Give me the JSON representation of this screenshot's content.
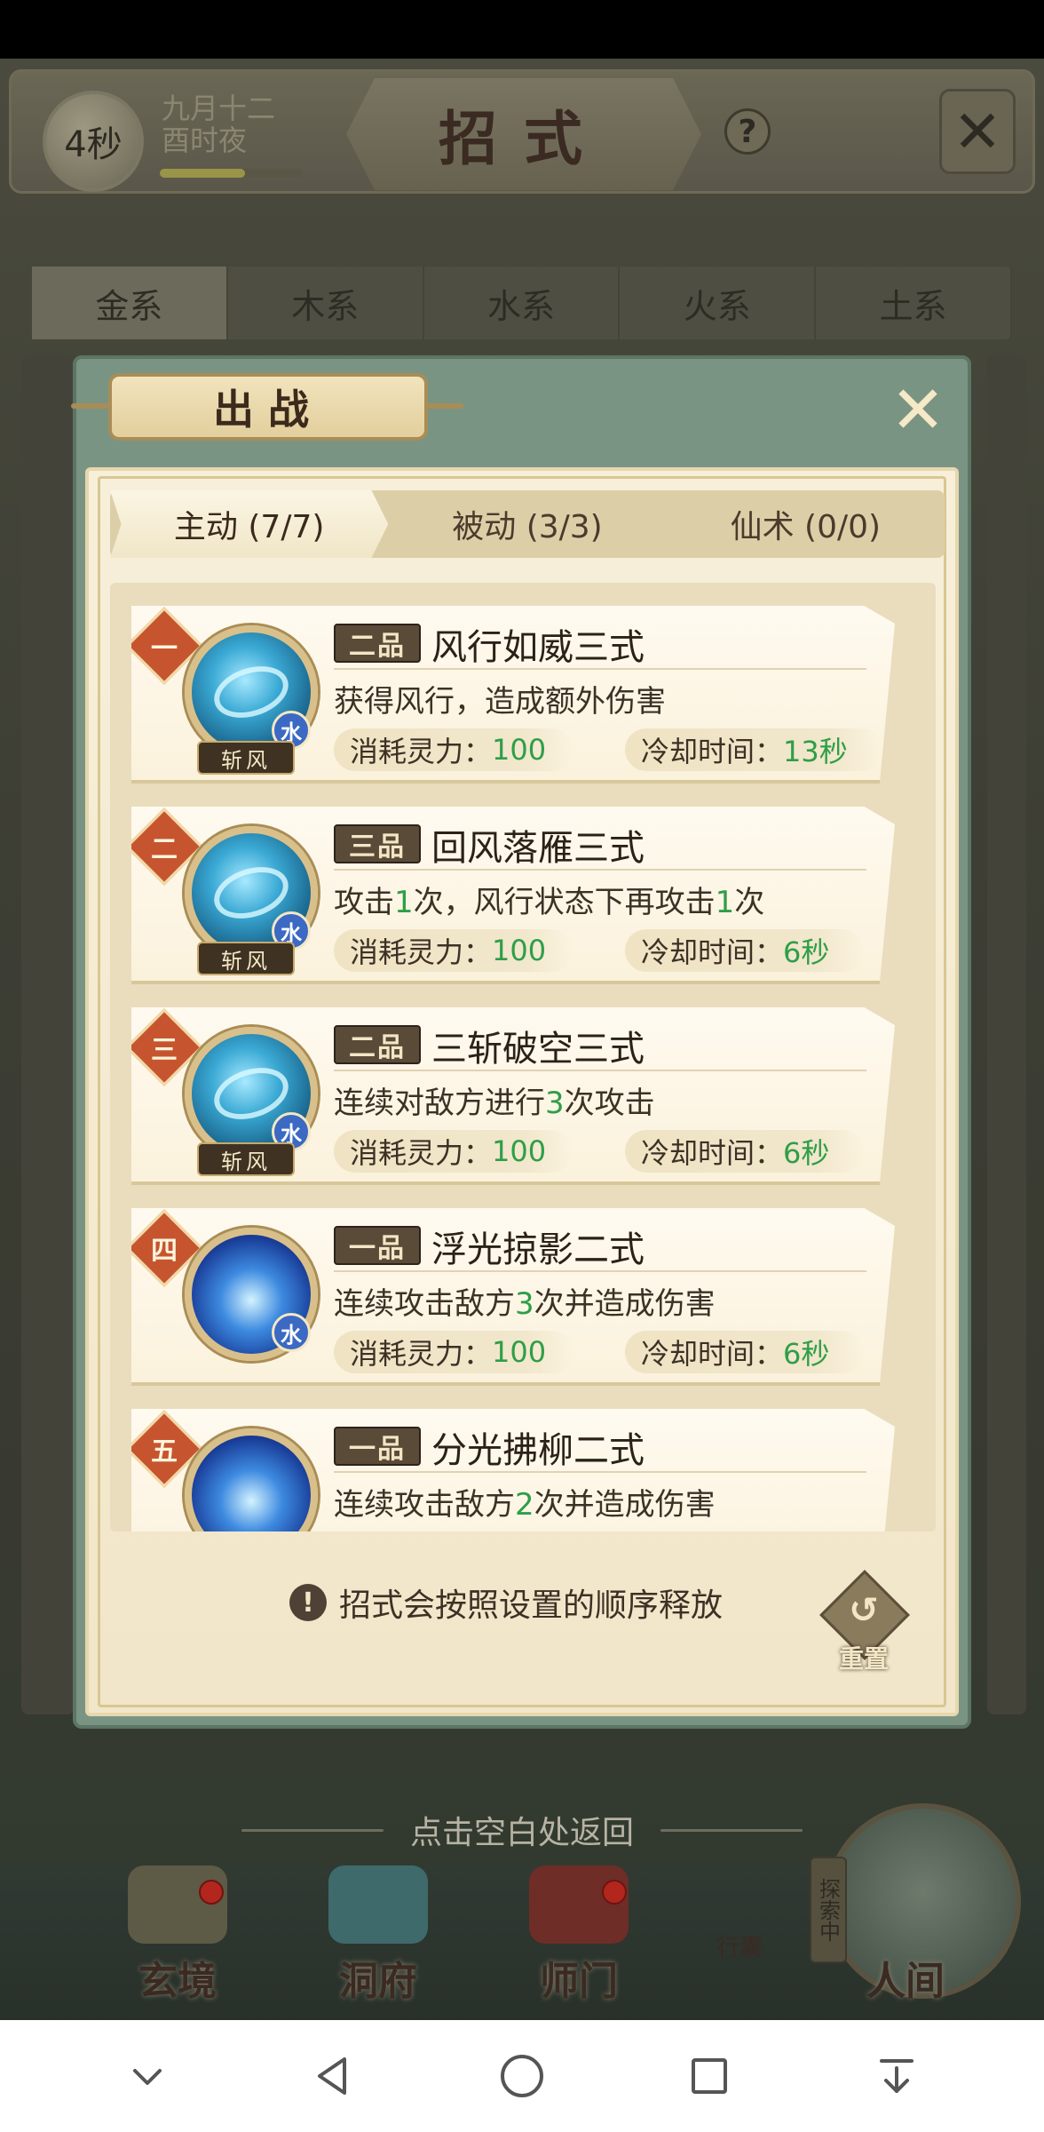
{
  "header": {
    "timer": "4秒",
    "date_line1": "九月十二",
    "date_line2": "酉时夜",
    "title": "招式",
    "help_glyph": "?",
    "time_progress": 0.6
  },
  "element_tabs": [
    "金系",
    "木系",
    "水系",
    "火系",
    "土系"
  ],
  "modal": {
    "title": "出战",
    "close_glyph": "✕",
    "subtabs": [
      "主动 (7/7)",
      "被动 (3/3)",
      "仙术 (0/0)"
    ],
    "skills": [
      {
        "rank": "一",
        "grade": "二品",
        "name": "风行如威三式",
        "desc": "获得风行，造成额外伤害",
        "element": "水",
        "style": "斩风",
        "cost_label": "消耗灵力：",
        "cost_value": "100",
        "cooldown_label": "冷却时间：",
        "cooldown_value": "13秒"
      },
      {
        "rank": "二",
        "grade": "三品",
        "name": "回风落雁三式",
        "desc_parts": [
          "攻击",
          "1",
          "次，风行状态下再攻击",
          "1",
          "次"
        ],
        "element": "水",
        "style": "斩风",
        "cost_label": "消耗灵力：",
        "cost_value": "100",
        "cooldown_label": "冷却时间：",
        "cooldown_value": "6秒"
      },
      {
        "rank": "三",
        "grade": "二品",
        "name": "三斩破空三式",
        "desc_parts": [
          "连续对敌方进行",
          "3",
          "次攻击"
        ],
        "element": "水",
        "style": "斩风",
        "cost_label": "消耗灵力：",
        "cost_value": "100",
        "cooldown_label": "冷却时间：",
        "cooldown_value": "6秒"
      },
      {
        "rank": "四",
        "grade": "一品",
        "name": "浮光掠影二式",
        "desc_parts": [
          "连续攻击敌方",
          "3",
          "次并造成伤害"
        ],
        "element": "水",
        "cost_label": "消耗灵力：",
        "cost_value": "100",
        "cooldown_label": "冷却时间：",
        "cooldown_value": "6秒"
      },
      {
        "rank": "五",
        "grade": "一品",
        "name": "分光拂柳二式",
        "desc_parts": [
          "连续攻击敌方",
          "2",
          "次并造成伤害"
        ]
      }
    ],
    "notice": "招式会按照设置的顺序释放",
    "notice_icon": "!",
    "reset_label": "重置"
  },
  "back_hint": "点击空白处返回",
  "bottom_nav": {
    "items": [
      "玄境",
      "洞府",
      "师门",
      "人间"
    ],
    "explore_tag": "探索中",
    "bag_label": "行囊"
  },
  "colors": {
    "accent_green": "#2f9e48",
    "rank_badge": "#c6552f",
    "modal_frame": "#7a9484",
    "parchment": "#f7efd9"
  }
}
